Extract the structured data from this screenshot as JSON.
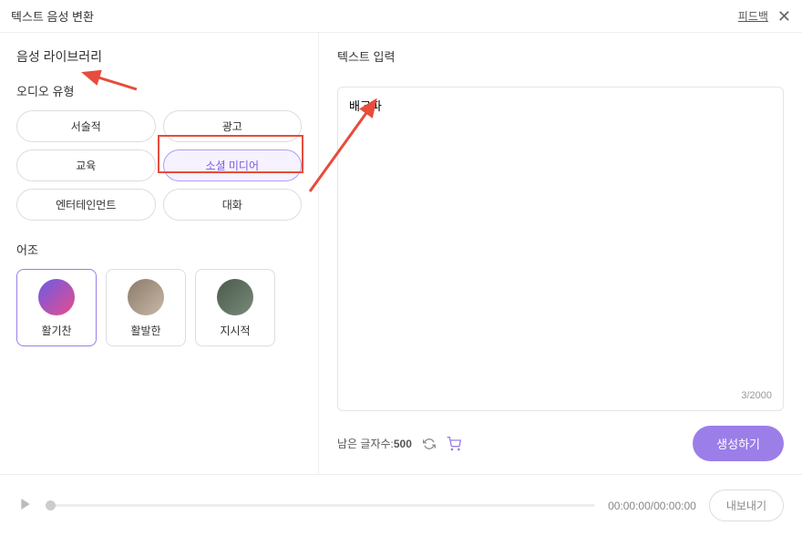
{
  "header": {
    "title": "텍스트 음성 변환",
    "feedback": "피드백"
  },
  "sidebar": {
    "library_title": "음성 라이브러리",
    "audio_type_label": "오디오 유형",
    "audio_types": {
      "narrative": "서술적",
      "ad": "광고",
      "education": "교육",
      "social": "소셜 미디어",
      "entertainment": "엔터테인먼트",
      "conversation": "대화"
    },
    "tone_label": "어조",
    "tones": {
      "energetic": "활기찬",
      "lively": "활발한",
      "directive": "지시적"
    }
  },
  "content": {
    "input_label": "텍스트 입력",
    "input_value": "배고파",
    "char_count": "3/2000",
    "remaining_label": "남은 글자수:",
    "remaining_value": "500",
    "generate_label": "생성하기"
  },
  "footer": {
    "time": "00:00:00/00:00:00",
    "export_label": "내보내기"
  }
}
